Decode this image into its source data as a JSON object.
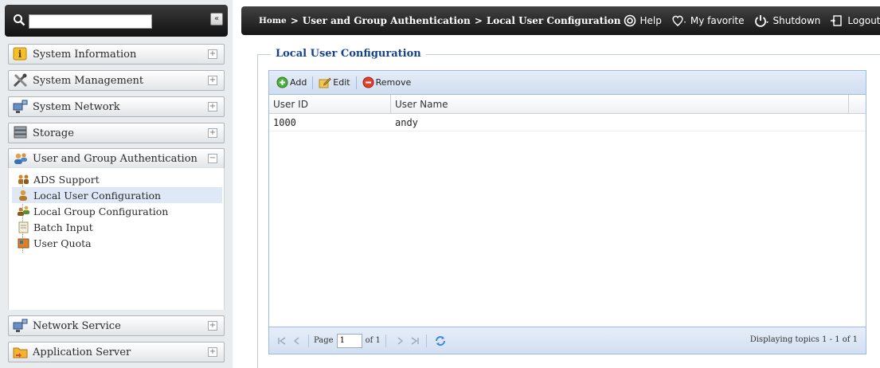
{
  "search": {
    "placeholder": "",
    "value": ""
  },
  "sidebar": {
    "collapse_label": "«",
    "categories": [
      {
        "label": "System Information",
        "toggle": "+",
        "icon": "info-icon"
      },
      {
        "label": "System Management",
        "toggle": "+",
        "icon": "tools-icon"
      },
      {
        "label": "System Network",
        "toggle": "+",
        "icon": "network-icon"
      },
      {
        "label": "Storage",
        "toggle": "+",
        "icon": "storage-icon"
      },
      {
        "label": "User and Group Authentication",
        "toggle": "−",
        "icon": "users-icon"
      },
      {
        "label": "Network Service",
        "toggle": "+",
        "icon": "network-service-icon"
      },
      {
        "label": "Application Server",
        "toggle": "+",
        "icon": "folder-icon"
      }
    ],
    "subitems": [
      {
        "label": "ADS Support",
        "icon": "ads-icon"
      },
      {
        "label": "Local User Configuration",
        "icon": "user-icon",
        "active": true
      },
      {
        "label": "Local Group Configuration",
        "icon": "group-icon"
      },
      {
        "label": "Batch Input",
        "icon": "batch-icon"
      },
      {
        "label": "User Quota",
        "icon": "quota-icon"
      }
    ]
  },
  "topbar": {
    "breadcrumb": [
      "Home",
      "User and Group Authentication",
      "Local User Configuration"
    ],
    "separator": ">",
    "help": "Help",
    "favorite": "My favorite",
    "shutdown": "Shutdown",
    "logout": "Logout"
  },
  "main": {
    "legend": "Local User Configuration",
    "toolbar": {
      "add": "Add",
      "edit": "Edit",
      "remove": "Remove"
    },
    "columns": [
      "User ID",
      "User Name"
    ],
    "rows": [
      [
        "1000",
        "andy"
      ]
    ],
    "pager": {
      "page_label": "Page",
      "page_value": "1",
      "of_label": "of 1",
      "info": "Displaying topics 1 - 1 of 1"
    }
  },
  "colors": {
    "accent": "#15428b",
    "grid_border": "#99bbe8",
    "topbar": "#1e1e1e"
  }
}
